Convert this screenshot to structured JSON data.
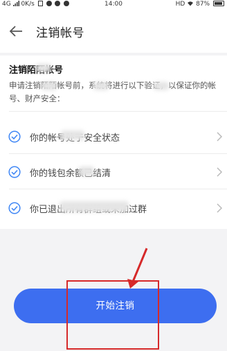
{
  "status_bar": {
    "left_text": "4G",
    "net_speed": "0K/s",
    "time": "14:00",
    "right_text": "HD",
    "battery": "87%"
  },
  "header": {
    "title": "注销帐号"
  },
  "info": {
    "title": "注销陌陌帐号",
    "description": "申请注销陌陌帐号前，系统将进行以下验证，以保证你的帐号、财产安全：",
    "conditions": [
      {
        "label": "你的帐号处于安全状态"
      },
      {
        "label": "你的钱包余额已结清"
      },
      {
        "label": "你已退出所有群组或未加过群"
      }
    ]
  },
  "start_button": {
    "label": "开始注销"
  },
  "colors": {
    "accent": "#3d6ef0",
    "check": "#3e86f5",
    "annotation": "#d6292a"
  }
}
